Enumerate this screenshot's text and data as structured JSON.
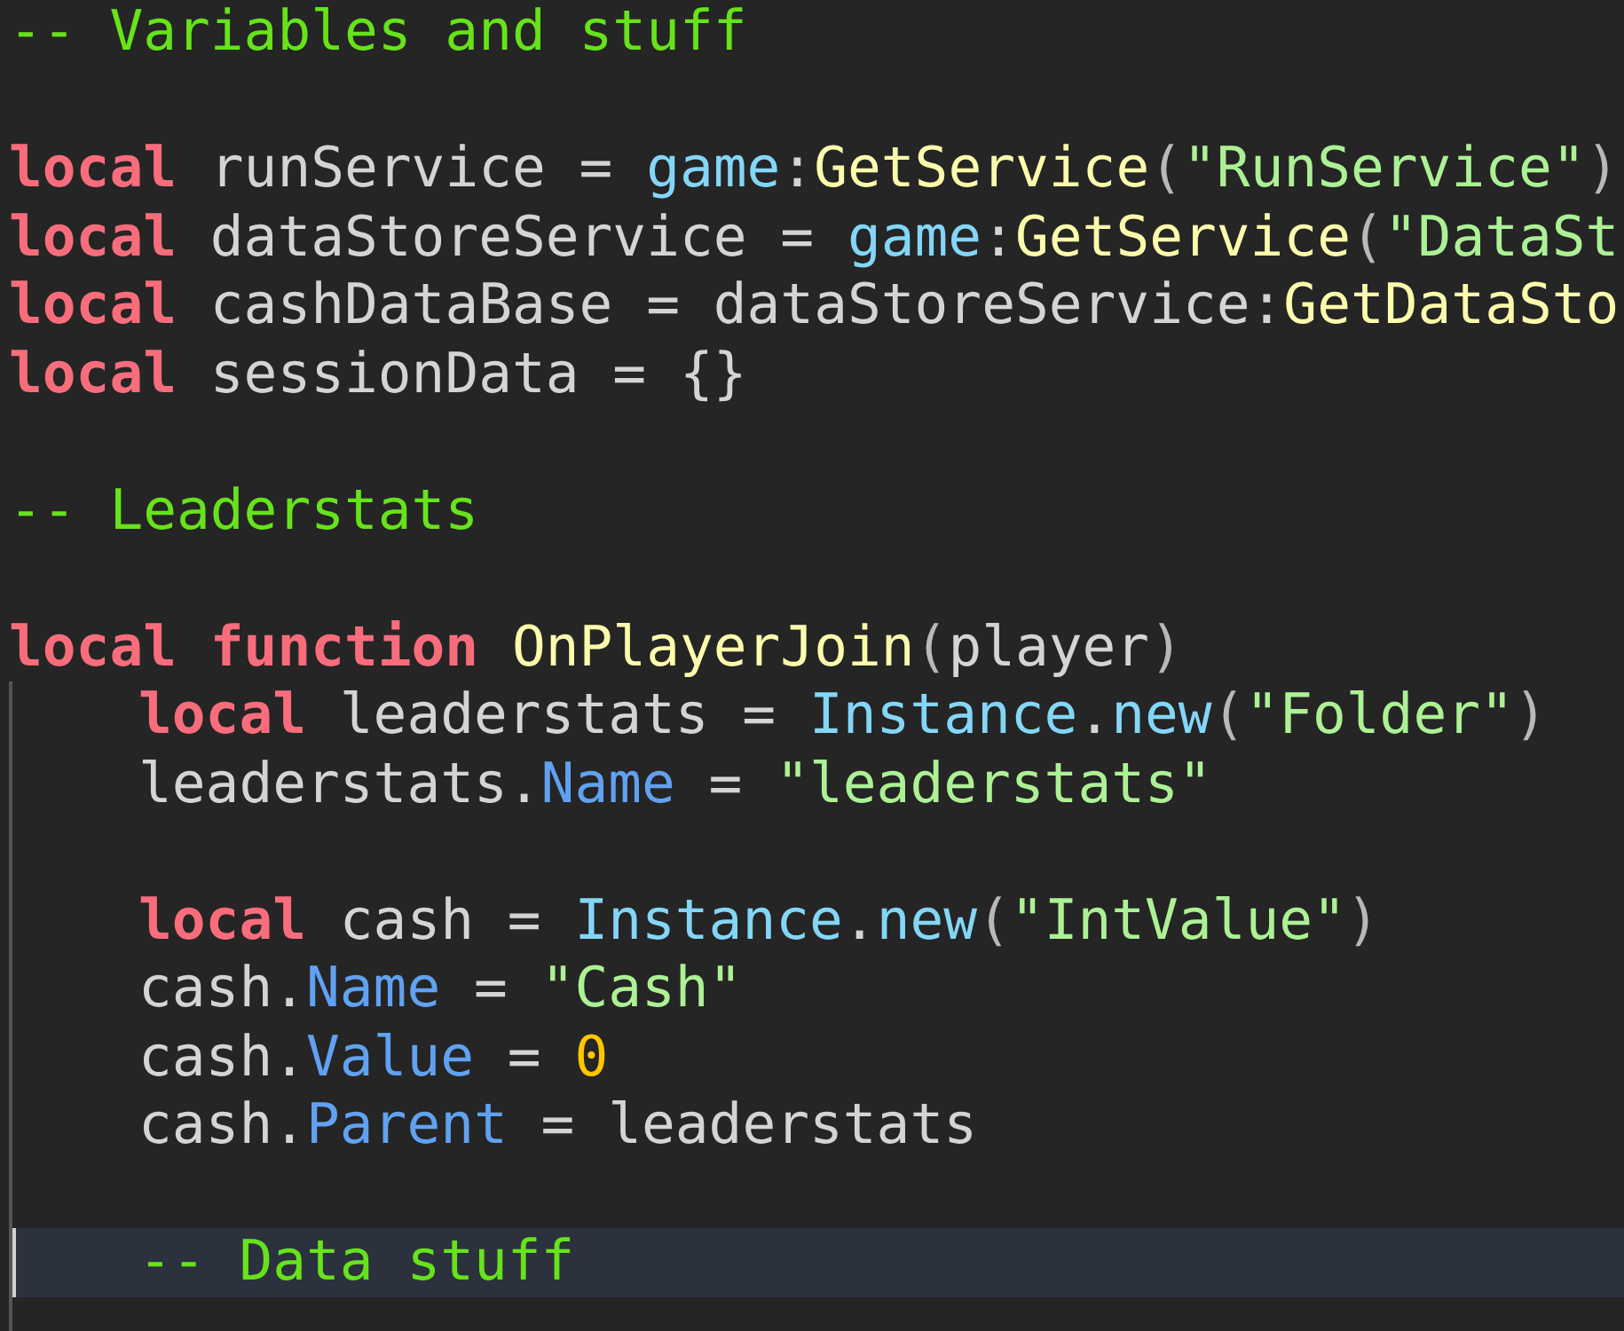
{
  "editor": {
    "lines": [
      {
        "kind": "code",
        "current": false,
        "tokens": [
          {
            "kind": "comment",
            "text": "-- Variables and stuff"
          }
        ]
      },
      {
        "kind": "blank",
        "current": false
      },
      {
        "kind": "code",
        "current": false,
        "tokens": [
          {
            "kind": "keyword",
            "text": "local"
          },
          {
            "kind": "plain",
            "text": " runService = "
          },
          {
            "kind": "global",
            "text": "game"
          },
          {
            "kind": "plain",
            "text": ":"
          },
          {
            "kind": "method",
            "text": "GetService"
          },
          {
            "kind": "punct",
            "text": "("
          },
          {
            "kind": "string",
            "text": "\"RunService\""
          },
          {
            "kind": "punct",
            "text": ")"
          }
        ]
      },
      {
        "kind": "code",
        "current": false,
        "tokens": [
          {
            "kind": "keyword",
            "text": "local"
          },
          {
            "kind": "plain",
            "text": " dataStoreService = "
          },
          {
            "kind": "global",
            "text": "game"
          },
          {
            "kind": "plain",
            "text": ":"
          },
          {
            "kind": "method",
            "text": "GetService"
          },
          {
            "kind": "punct",
            "text": "("
          },
          {
            "kind": "string",
            "text": "\"DataSt"
          }
        ]
      },
      {
        "kind": "code",
        "current": false,
        "tokens": [
          {
            "kind": "keyword",
            "text": "local"
          },
          {
            "kind": "plain",
            "text": " cashDataBase = dataStoreService:"
          },
          {
            "kind": "method",
            "text": "GetDataSto"
          }
        ]
      },
      {
        "kind": "code",
        "current": false,
        "tokens": [
          {
            "kind": "keyword",
            "text": "local"
          },
          {
            "kind": "plain",
            "text": " sessionData = {}"
          }
        ]
      },
      {
        "kind": "blank",
        "current": false
      },
      {
        "kind": "code",
        "current": false,
        "tokens": [
          {
            "kind": "comment",
            "text": "-- Leaderstats"
          }
        ]
      },
      {
        "kind": "blank",
        "current": false
      },
      {
        "kind": "code",
        "current": false,
        "tokens": [
          {
            "kind": "keyword",
            "text": "local"
          },
          {
            "kind": "keyword",
            "text": "function",
            "space_before": true
          },
          {
            "kind": "method",
            "text": "OnPlayerJoin",
            "space_before": true
          },
          {
            "kind": "punct",
            "text": "("
          },
          {
            "kind": "plain",
            "text": "player"
          },
          {
            "kind": "punct",
            "text": ")"
          }
        ],
        "children": [
          {
            "kind": "code",
            "current": false,
            "tokens": [
              {
                "kind": "keyword",
                "text": "local"
              },
              {
                "kind": "plain",
                "text": " leaderstats = "
              },
              {
                "kind": "global",
                "text": "Instance"
              },
              {
                "kind": "plain",
                "text": "."
              },
              {
                "kind": "global",
                "text": "new"
              },
              {
                "kind": "punct",
                "text": "("
              },
              {
                "kind": "string",
                "text": "\"Folder\""
              },
              {
                "kind": "punct",
                "text": ")"
              }
            ]
          },
          {
            "kind": "code",
            "current": false,
            "tokens": [
              {
                "kind": "plain",
                "text": "leaderstats."
              },
              {
                "kind": "property",
                "text": "Name"
              },
              {
                "kind": "plain",
                "text": " = "
              },
              {
                "kind": "string",
                "text": "\"leaderstats\""
              }
            ]
          },
          {
            "kind": "blank",
            "current": false
          },
          {
            "kind": "code",
            "current": false,
            "tokens": [
              {
                "kind": "keyword",
                "text": "local"
              },
              {
                "kind": "plain",
                "text": " cash = "
              },
              {
                "kind": "global",
                "text": "Instance"
              },
              {
                "kind": "plain",
                "text": "."
              },
              {
                "kind": "global",
                "text": "new"
              },
              {
                "kind": "punct",
                "text": "("
              },
              {
                "kind": "string",
                "text": "\"IntValue\""
              },
              {
                "kind": "punct",
                "text": ")"
              }
            ]
          },
          {
            "kind": "code",
            "current": false,
            "tokens": [
              {
                "kind": "plain",
                "text": "cash."
              },
              {
                "kind": "property",
                "text": "Name"
              },
              {
                "kind": "plain",
                "text": " = "
              },
              {
                "kind": "string",
                "text": "\"Cash\""
              }
            ]
          },
          {
            "kind": "code",
            "current": false,
            "tokens": [
              {
                "kind": "plain",
                "text": "cash."
              },
              {
                "kind": "property",
                "text": "Value"
              },
              {
                "kind": "plain",
                "text": " = "
              },
              {
                "kind": "number",
                "text": "0"
              }
            ]
          },
          {
            "kind": "code",
            "current": false,
            "tokens": [
              {
                "kind": "plain",
                "text": "cash."
              },
              {
                "kind": "property",
                "text": "Parent"
              },
              {
                "kind": "plain",
                "text": " = leaderstats"
              }
            ]
          },
          {
            "kind": "blank",
            "current": false
          },
          {
            "kind": "code",
            "current": true,
            "tokens": [
              {
                "kind": "comment",
                "text": "-- Data stuff"
              }
            ]
          }
        ]
      }
    ]
  }
}
